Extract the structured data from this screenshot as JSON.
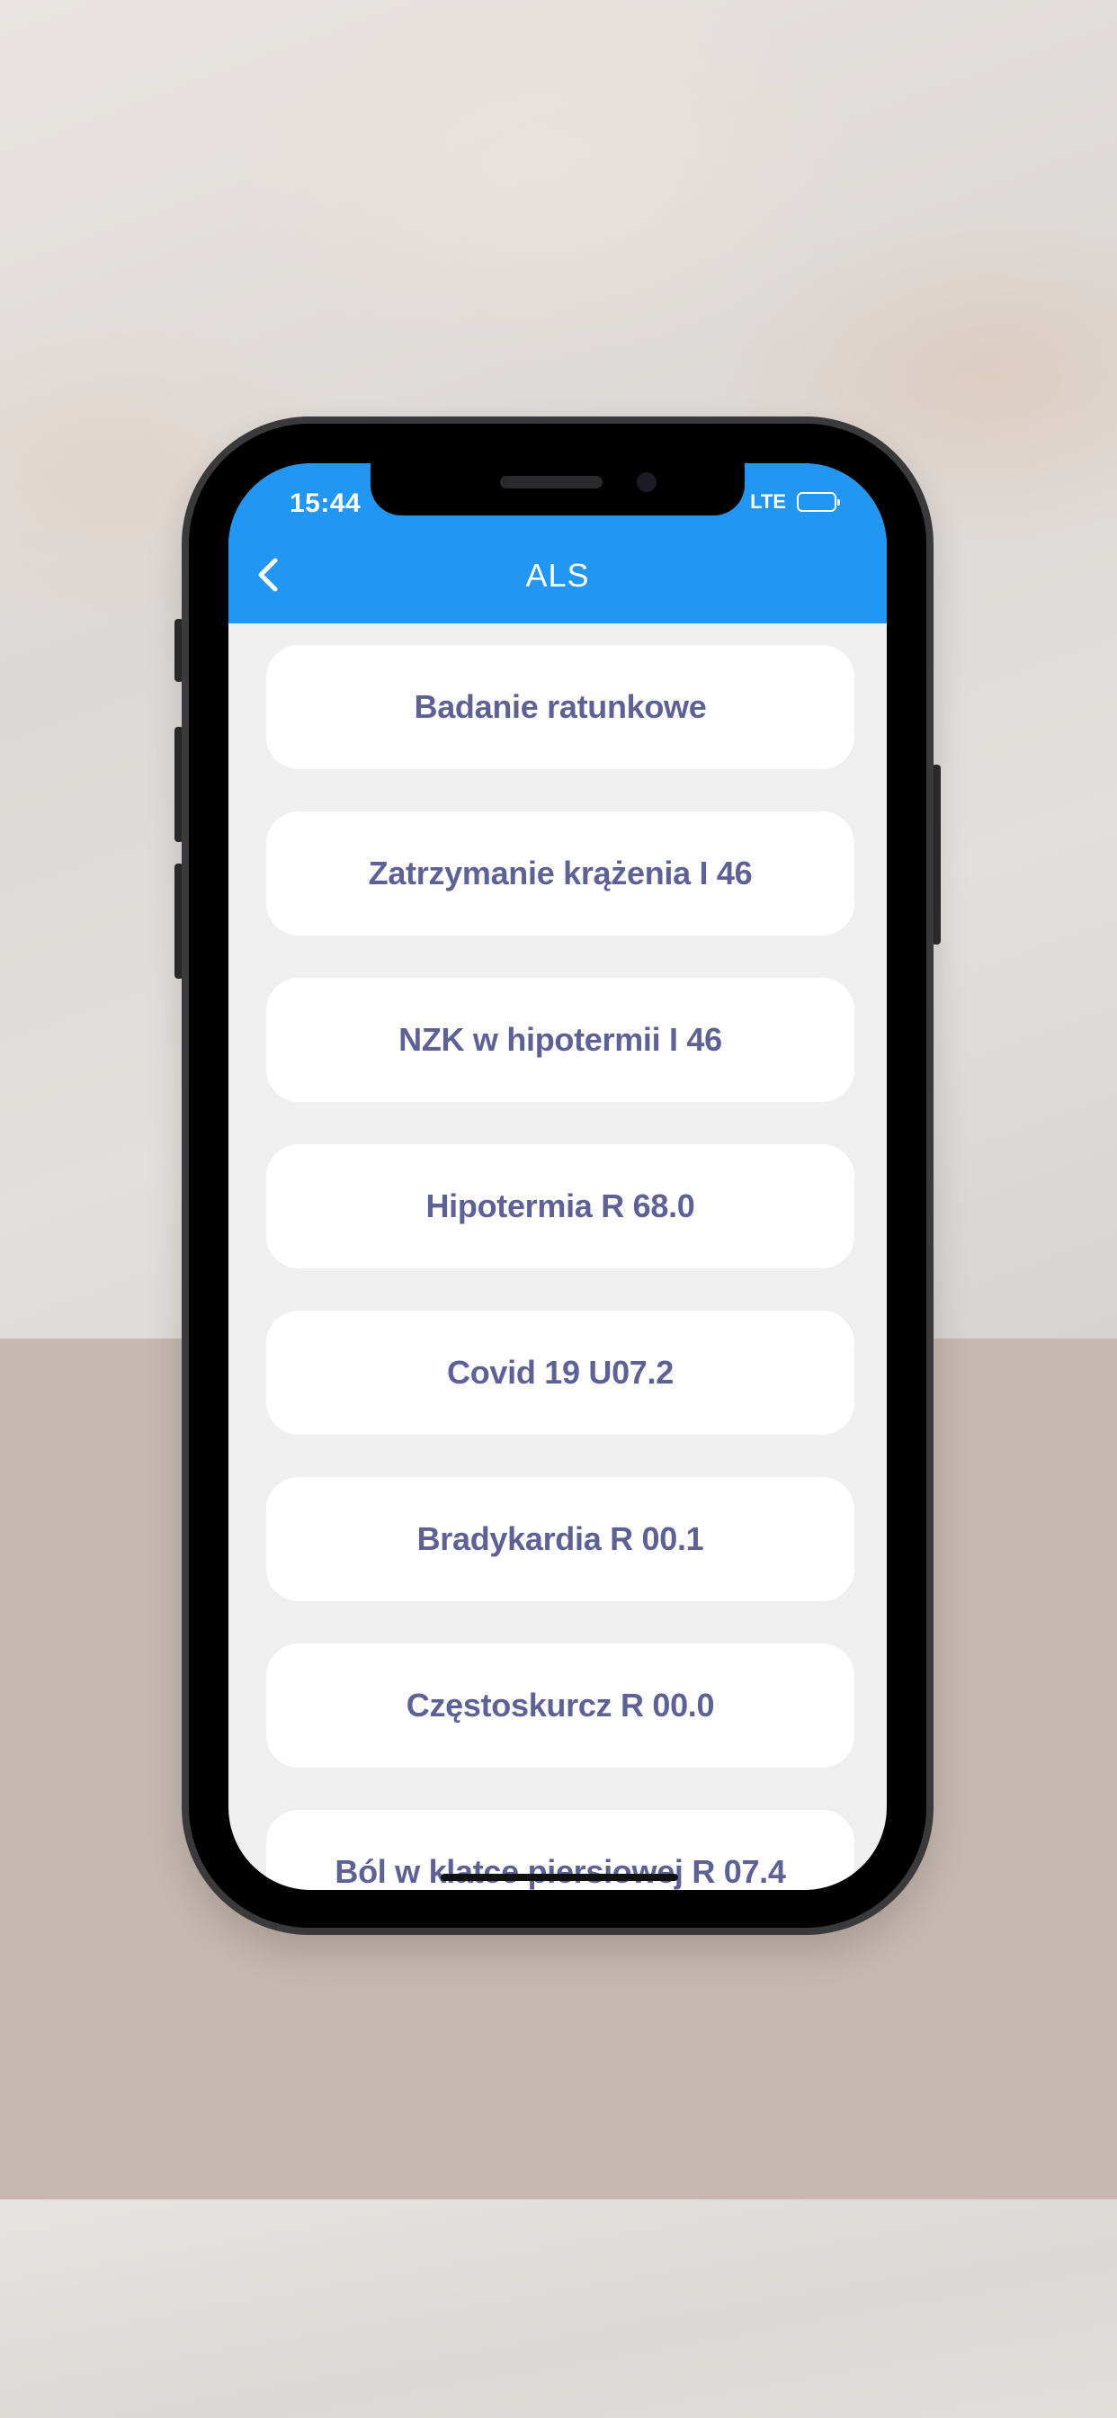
{
  "status_bar": {
    "time": "15:44",
    "network": "LTE",
    "battery_icon": "battery-icon"
  },
  "app_bar": {
    "title": "ALS",
    "back_icon": "chevron-left-icon",
    "color": "#2196f3"
  },
  "list": {
    "items": [
      {
        "label": "Badanie ratunkowe"
      },
      {
        "label": "Zatrzymanie krążenia I 46"
      },
      {
        "label": "NZK w hipotermii I 46"
      },
      {
        "label": "Hipotermia R 68.0"
      },
      {
        "label": "Covid 19 U07.2"
      },
      {
        "label": "Bradykardia R 00.1"
      },
      {
        "label": "Częstoskurcz R 00.0"
      },
      {
        "label": "Ból w klatce piersiowej R 07.4"
      }
    ],
    "text_color": "#5e6196"
  }
}
